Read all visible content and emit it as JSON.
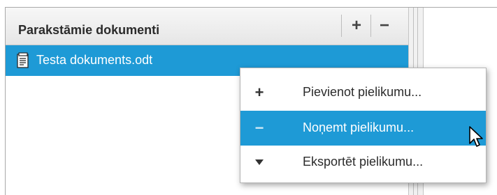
{
  "panel": {
    "title": "Parakstāmie dokumenti",
    "add_button": "+",
    "remove_button": "−"
  },
  "documents": [
    {
      "name": "Testa dokuments.odt",
      "icon": "document-icon",
      "selected": true
    }
  ],
  "context_menu": {
    "items": [
      {
        "glyph": "+",
        "label": "Pievienot pielikumu...",
        "icon": "plus-icon"
      },
      {
        "glyph": "−",
        "label": "Noņemt pielikumu...",
        "icon": "minus-icon",
        "highlighted": true
      },
      {
        "glyph": "▼",
        "label": "Eksportēt pielikumu...",
        "icon": "arrow-down-icon"
      }
    ]
  },
  "colors": {
    "selection": "#1e9ad6",
    "text": "#2b2b2b"
  }
}
